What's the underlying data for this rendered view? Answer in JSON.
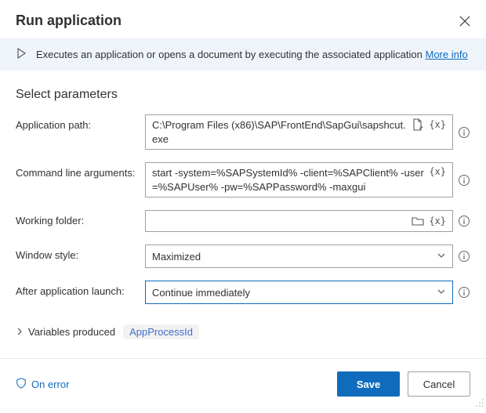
{
  "header": {
    "title": "Run application"
  },
  "infobar": {
    "text": "Executes an application or opens a document by executing the associated application ",
    "more_info": "More info"
  },
  "section_title": "Select parameters",
  "fields": {
    "app_path": {
      "label": "Application path:",
      "value": "C:\\Program Files (x86)\\SAP\\FrontEnd\\SapGui\\sapshcut.exe"
    },
    "cmd_args": {
      "label": "Command line arguments:",
      "value": "start -system=%SAPSystemId% -client=%SAPClient% -user=%SAPUser% -pw=%SAPPassword% -maxgui"
    },
    "working_folder": {
      "label": "Working folder:",
      "value": ""
    },
    "window_style": {
      "label": "Window style:",
      "value": "Maximized"
    },
    "after_launch": {
      "label": "After application launch:",
      "value": "Continue immediately"
    }
  },
  "var_token": "{x}",
  "variables_produced": {
    "label": "Variables produced",
    "badge": "AppProcessId"
  },
  "footer": {
    "on_error": "On error",
    "save": "Save",
    "cancel": "Cancel"
  }
}
